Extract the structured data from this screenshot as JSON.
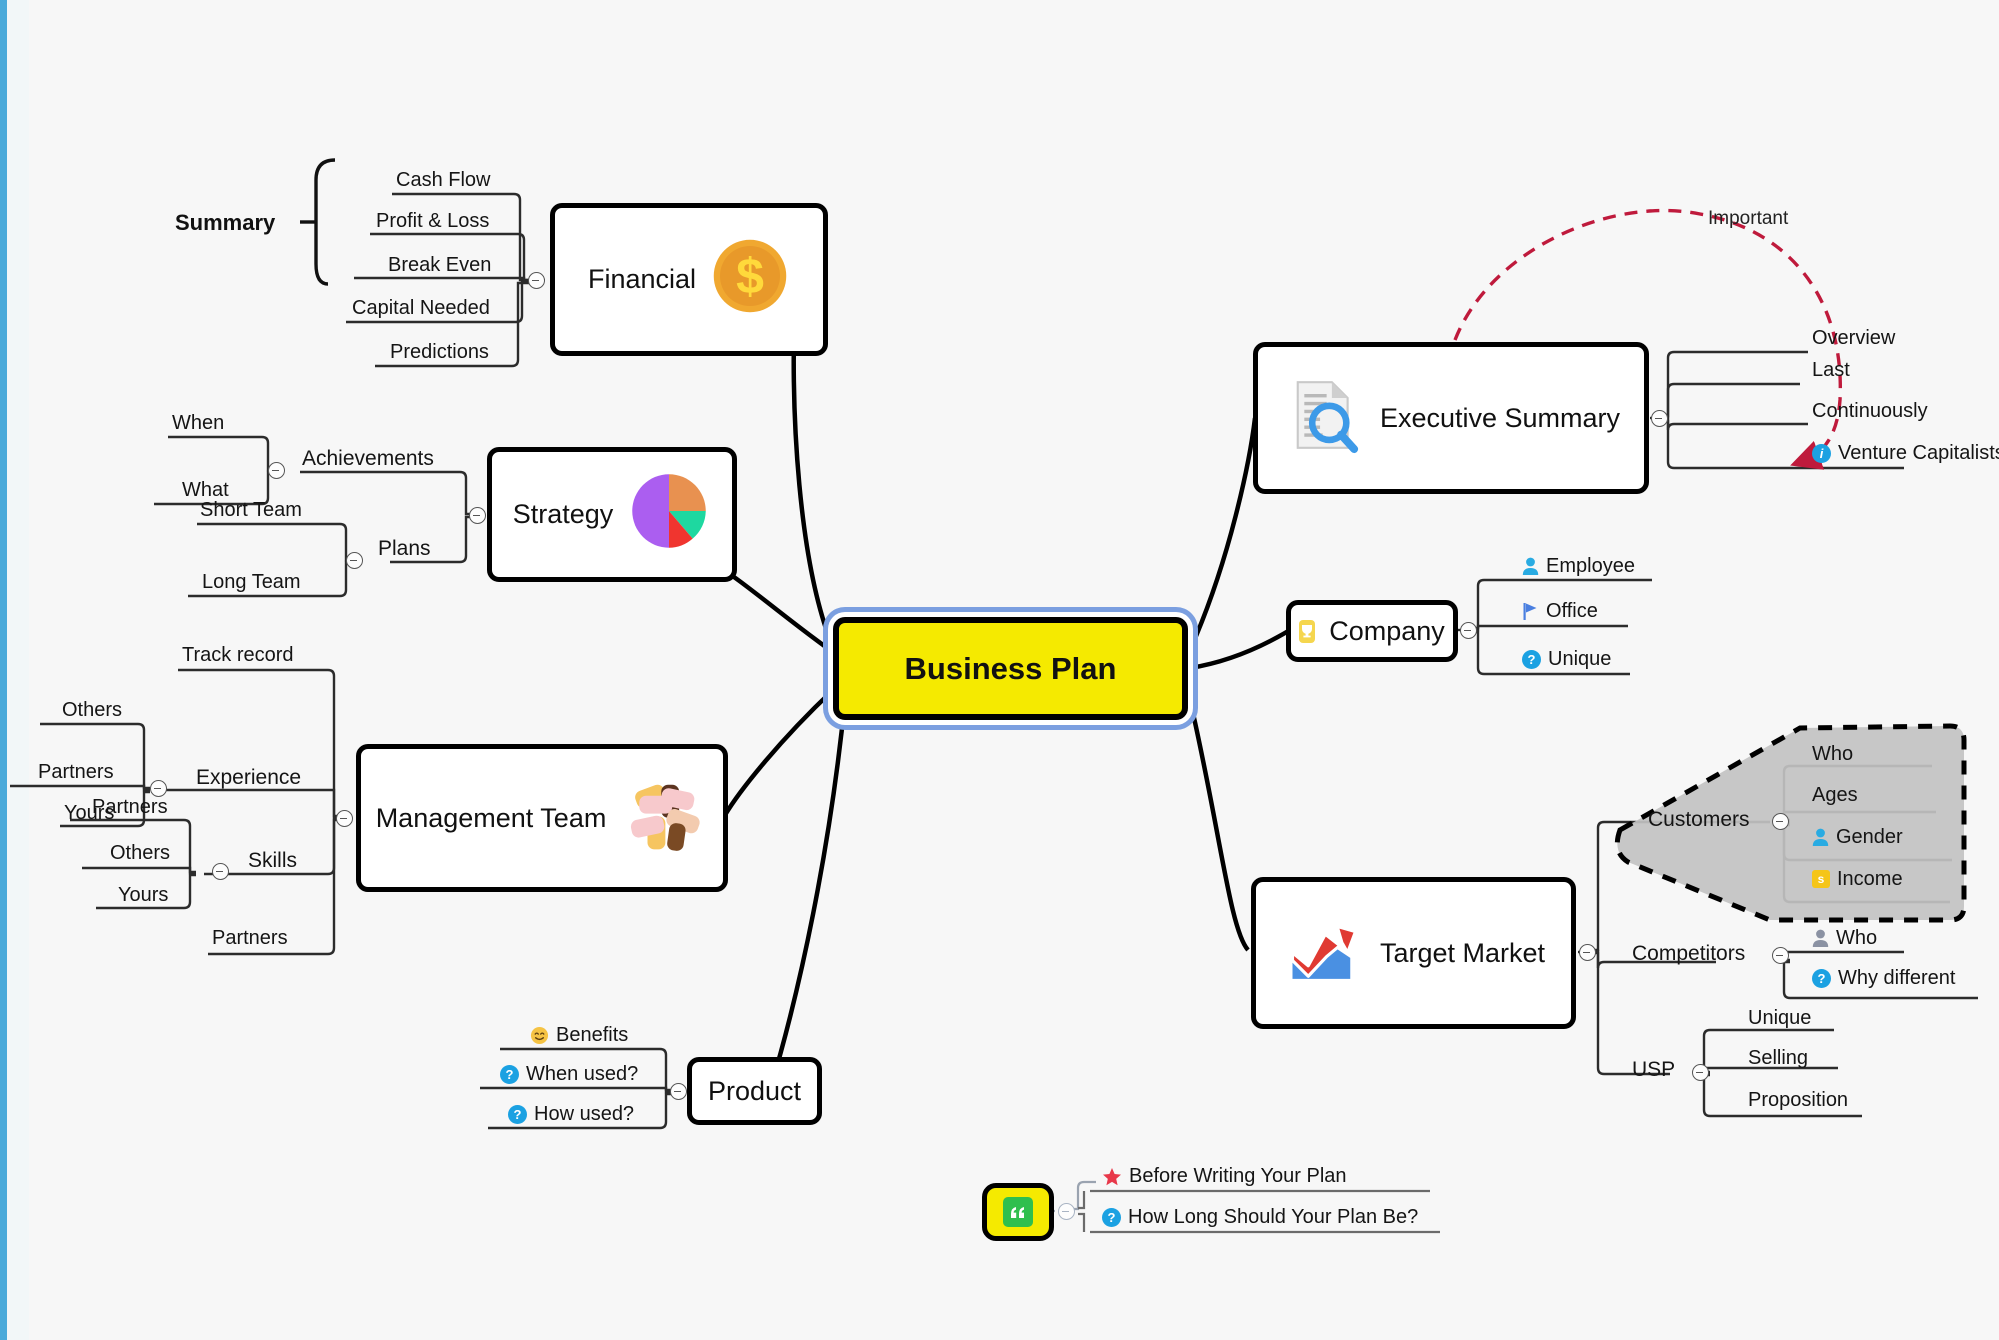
{
  "canvas": {
    "background": "#f7f7f7",
    "edge_accent": "#4aaada"
  },
  "central": {
    "label": "Business Plan",
    "fill": "#f5ea00",
    "selection_color": "#7b9fe0"
  },
  "branches": {
    "financial": {
      "label": "Financial",
      "icon": "gold-coin-dollar-icon",
      "group_label": "Summary",
      "children": [
        {
          "label": "Cash Flow"
        },
        {
          "label": "Profit & Loss"
        },
        {
          "label": "Break Even"
        },
        {
          "label": "Capital Needed"
        },
        {
          "label": "Predictions"
        }
      ]
    },
    "strategy": {
      "label": "Strategy",
      "icon": "pie-chart-icon",
      "children": [
        {
          "label": "Achievements",
          "children": [
            {
              "label": "When"
            },
            {
              "label": "What"
            }
          ]
        },
        {
          "label": "Plans",
          "children": [
            {
              "label": "Short Team"
            },
            {
              "label": "Long Team"
            }
          ]
        }
      ]
    },
    "management_team": {
      "label": "Management Team",
      "icon": "handshake-hands-icon",
      "children": [
        {
          "label": "Track record"
        },
        {
          "label": "Experience",
          "children": [
            {
              "label": "Others"
            },
            {
              "label": "Partners"
            },
            {
              "label": "Yours"
            }
          ]
        },
        {
          "label": "Skills",
          "children": [
            {
              "label": "Partners"
            },
            {
              "label": "Others"
            },
            {
              "label": "Yours"
            }
          ]
        },
        {
          "label": "Partners"
        }
      ]
    },
    "product": {
      "label": "Product",
      "children": [
        {
          "label": "Benefits",
          "icon": "smiley-icon"
        },
        {
          "label": "When used?",
          "icon": "question-icon"
        },
        {
          "label": "How used?",
          "icon": "question-icon"
        }
      ]
    },
    "executive_summary": {
      "label": "Executive Summary",
      "icon": "document-magnifier-icon",
      "children": [
        {
          "label": "Overview"
        },
        {
          "label": "Last"
        },
        {
          "label": "Continuously"
        },
        {
          "label": "Venture Capitalists",
          "icon": "info-icon"
        }
      ],
      "relationship": {
        "label": "Important",
        "color": "#bf1a3c",
        "style": "dashed-arrow"
      }
    },
    "company": {
      "label": "Company",
      "icon": "trophy-icon",
      "children": [
        {
          "label": "Employee",
          "icon": "person-icon"
        },
        {
          "label": "Office",
          "icon": "flag-icon"
        },
        {
          "label": "Unique",
          "icon": "question-icon"
        }
      ]
    },
    "target_market": {
      "label": "Target Market",
      "icon": "growth-chart-icon",
      "children": [
        {
          "label": "Customers",
          "boundary": {
            "fill": "#c2c2c2",
            "style": "dashed"
          },
          "children": [
            {
              "label": "Who"
            },
            {
              "label": "Ages"
            },
            {
              "label": "Gender",
              "icon": "person-icon"
            },
            {
              "label": "Income",
              "icon": "money-icon"
            }
          ]
        },
        {
          "label": "Competitors",
          "children": [
            {
              "label": "Who",
              "icon": "person-gray-icon"
            },
            {
              "label": "Why different",
              "icon": "question-icon"
            }
          ]
        },
        {
          "label": "USP",
          "children": [
            {
              "label": "Unique"
            },
            {
              "label": "Selling"
            },
            {
              "label": "Proposition"
            }
          ]
        }
      ]
    }
  },
  "floating_note": {
    "icon": "quote-icon",
    "fill": "#f5ea00",
    "children": [
      {
        "label": "Before Writing Your Plan",
        "icon": "star-icon"
      },
      {
        "label": "How Long Should Your Plan Be?",
        "icon": "question-icon"
      }
    ]
  }
}
